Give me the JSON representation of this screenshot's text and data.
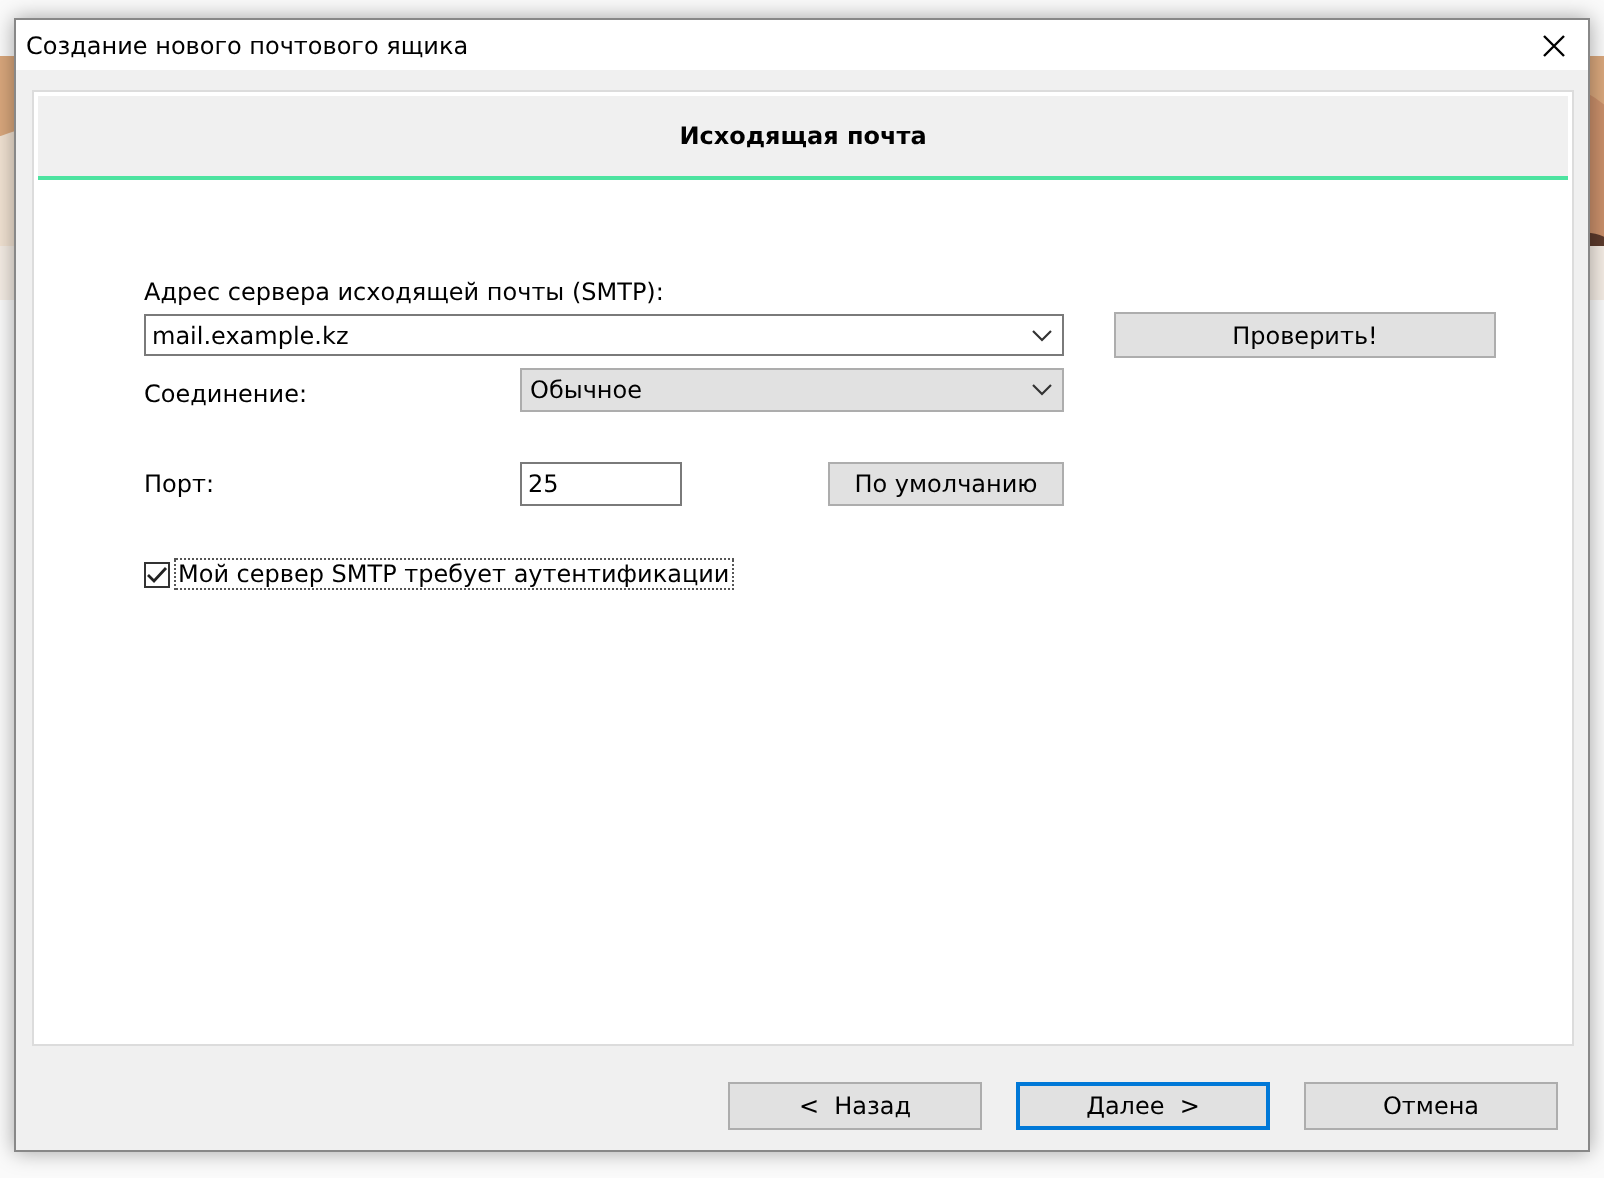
{
  "window": {
    "title": "Создание нового почтового ящика"
  },
  "header": {
    "title": "Исходящая почта"
  },
  "form": {
    "server_label": "Адрес сервера исходящей почты (SMTP):",
    "server_value": "mail.example.kz",
    "check_button": "Проверить!",
    "connection_label": "Соединение:",
    "connection_value": "Обычное",
    "port_label": "Порт:",
    "port_value": "25",
    "default_button": "По умолчанию",
    "auth": {
      "label": "Мой сервер SMTP требует аутентификации",
      "checked": true
    }
  },
  "buttons": [
    {
      "label": "<  Назад",
      "default": false
    },
    {
      "label": "Далее  >",
      "default": true
    },
    {
      "label": "Отмена",
      "default": false
    }
  ]
}
